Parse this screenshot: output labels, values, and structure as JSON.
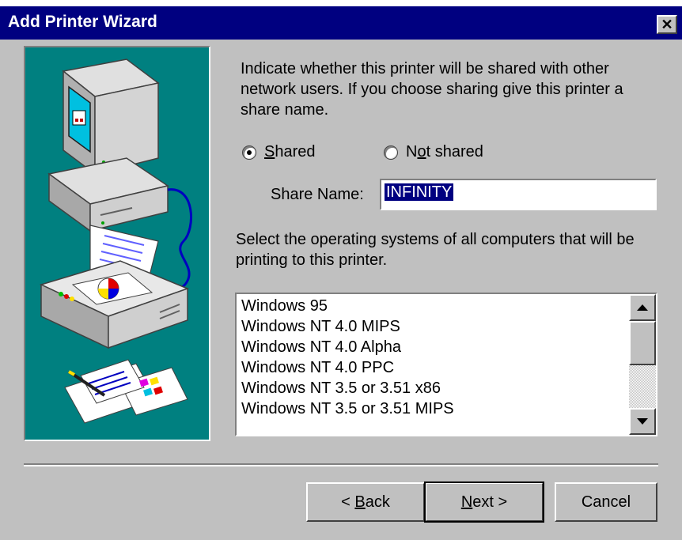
{
  "window": {
    "title": "Add Printer Wizard",
    "close_glyph": "✕"
  },
  "illustration": {
    "icon": "computer-printer-documents-illustration",
    "background": "#008080"
  },
  "sharing": {
    "instruction": "Indicate whether this printer will be shared with other network users.  If you choose sharing give this printer a share name.",
    "shared_label_pre": "",
    "shared_label_key": "S",
    "shared_label_post": "hared",
    "not_shared_label_pre": "N",
    "not_shared_label_key": "o",
    "not_shared_label_post": "t shared",
    "selected": "Shared",
    "share_name_label": "Share Name:",
    "share_name_value": "INFINITY"
  },
  "os": {
    "instruction": "Select the operating systems of all computers that will be printing to this printer.",
    "items": [
      "Windows 95",
      "Windows NT 4.0 MIPS",
      "Windows NT 4.0 Alpha",
      "Windows NT 4.0 PPC",
      "Windows NT 3.5 or 3.51 x86",
      "Windows NT 3.5 or 3.51 MIPS"
    ]
  },
  "buttons": {
    "back_pre": "< ",
    "back_key": "B",
    "back_post": "ack",
    "next_key": "N",
    "next_post": "ext >",
    "cancel": "Cancel"
  },
  "colors": {
    "titlebar": "#000080",
    "face": "#c0c0c0",
    "selection": "#000080"
  }
}
